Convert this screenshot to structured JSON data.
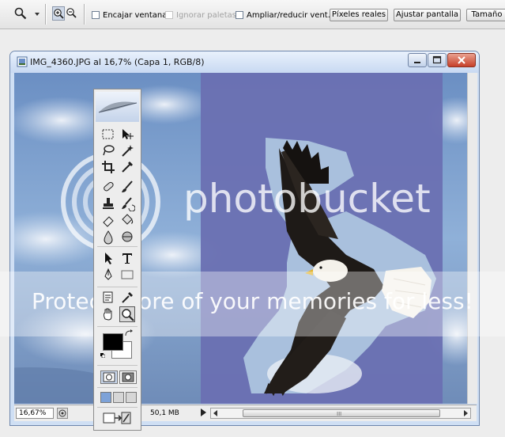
{
  "options_bar": {
    "fit_window_label": "Encajar ventana",
    "ignore_palettes_label": "Ignorar paletas",
    "resize_windows_label": "Ampliar/reducir vent.",
    "actual_pixels_label": "Píxeles reales",
    "fit_screen_label": "Ajustar pantalla",
    "print_size_label": "Tamaño"
  },
  "document": {
    "title": "IMG_4360.JPG al 16,7% (Capa 1, RGB/8)",
    "zoom_value": "16,67%",
    "doc_size": "50,1 MB",
    "scroll_grip": "III"
  },
  "tools_panel": {
    "quick_mask_tools": [
      "standard-mode",
      "quick-mask-mode"
    ],
    "screen_modes": [
      "standard-screen",
      "full-screen-menu",
      "full-screen"
    ]
  },
  "watermark": {
    "brand": "photobucket",
    "tagline": "Protect more of your memories for less!"
  },
  "colors": {
    "foreground": "#000000",
    "background": "#ffffff",
    "window_frame": "#cfdff4",
    "selection_overlay": "#6a70b2"
  }
}
